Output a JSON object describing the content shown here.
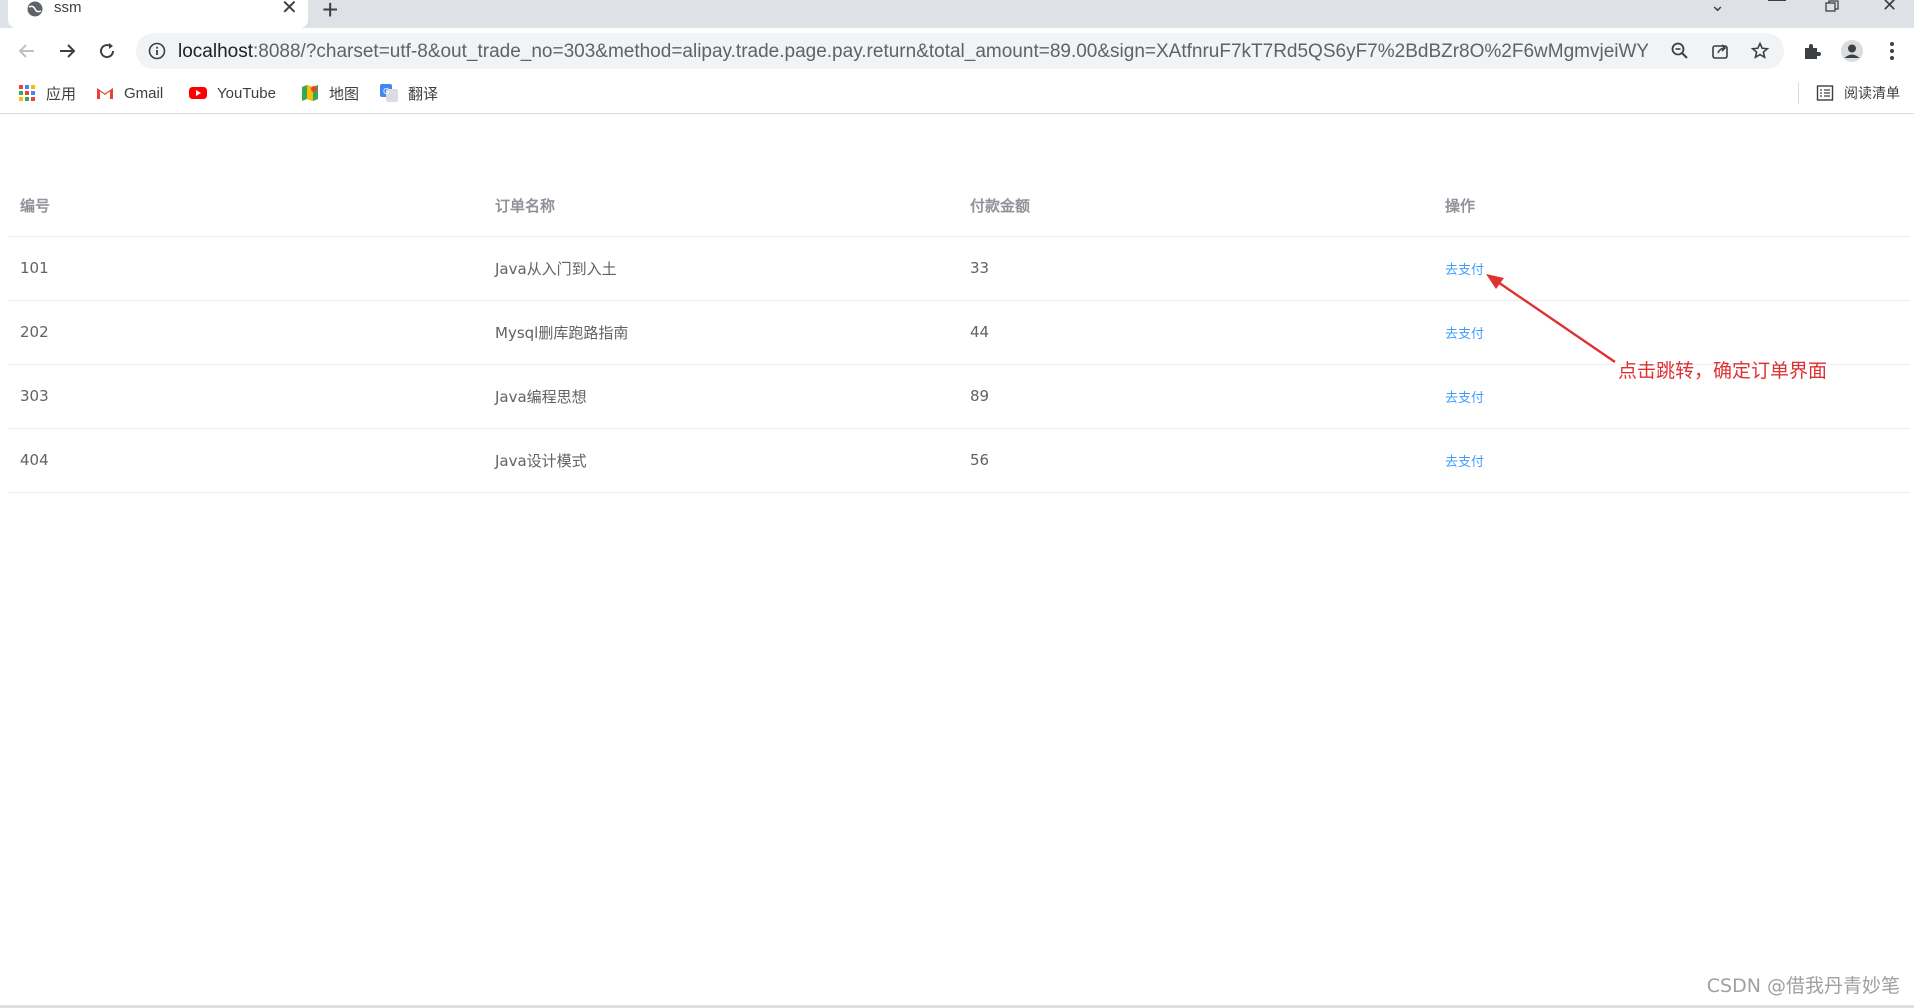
{
  "browser": {
    "tab_title": "ssm",
    "url_host": "localhost",
    "url_rest": ":8088/?charset=utf-8&out_trade_no=303&method=alipay.trade.page.pay.return&total_amount=89.00&sign=XAtfnruF7kT7Rd5QS6yF7%2BdBZr8O%2F6wMgmvjeiWY...",
    "bookmarks": [
      {
        "label": "应用",
        "icon": "apps-grid-icon"
      },
      {
        "label": "Gmail",
        "icon": "gmail-icon"
      },
      {
        "label": "YouTube",
        "icon": "youtube-icon"
      },
      {
        "label": "地图",
        "icon": "maps-icon"
      },
      {
        "label": "翻译",
        "icon": "translate-icon"
      }
    ],
    "reading_list": "阅读清单"
  },
  "table": {
    "headers": [
      "编号",
      "订单名称",
      "付款金额",
      "操作"
    ],
    "rows": [
      {
        "id": "101",
        "name": "Java从入门到入土",
        "amount": "33",
        "action": "去支付"
      },
      {
        "id": "202",
        "name": "Mysql删库跑路指南",
        "amount": "44",
        "action": "去支付"
      },
      {
        "id": "303",
        "name": "Java编程思想",
        "amount": "89",
        "action": "去支付"
      },
      {
        "id": "404",
        "name": "Java设计模式",
        "amount": "56",
        "action": "去支付"
      }
    ]
  },
  "annotation": {
    "text": "点击跳转，确定订单界面",
    "color": "#e03131"
  },
  "watermark": "CSDN @借我丹青妙笔",
  "colors": {
    "link": "#409eff",
    "header_text": "#909399",
    "cell_text": "#606266"
  }
}
